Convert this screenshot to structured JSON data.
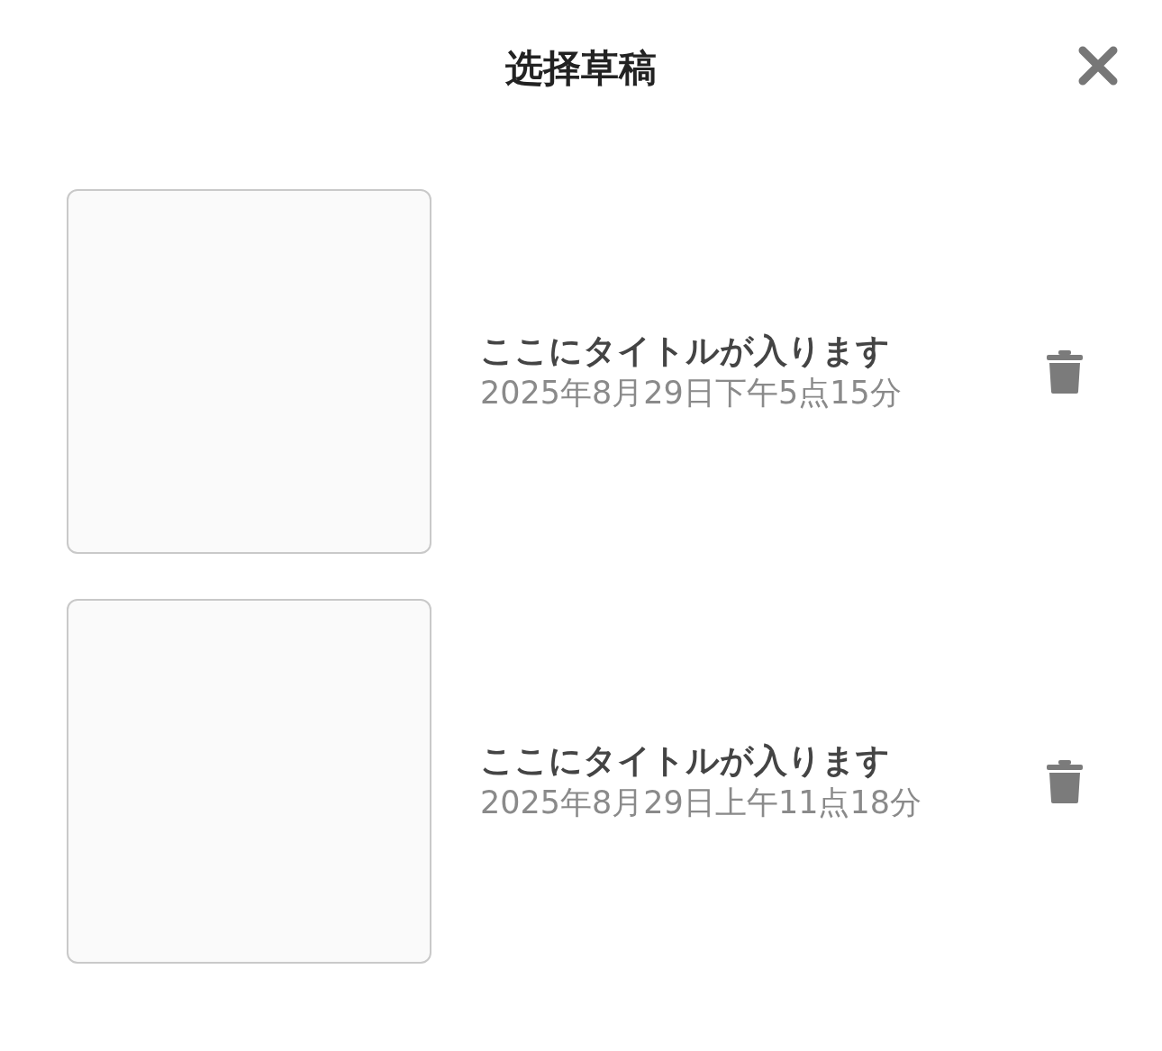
{
  "header": {
    "title": "选择草稿"
  },
  "drafts": [
    {
      "title": "ここにタイトルが入ります",
      "date": "2025年8月29日下午5点15分"
    },
    {
      "title": "ここにタイトルが入ります",
      "date": "2025年8月29日上午11点18分"
    }
  ]
}
